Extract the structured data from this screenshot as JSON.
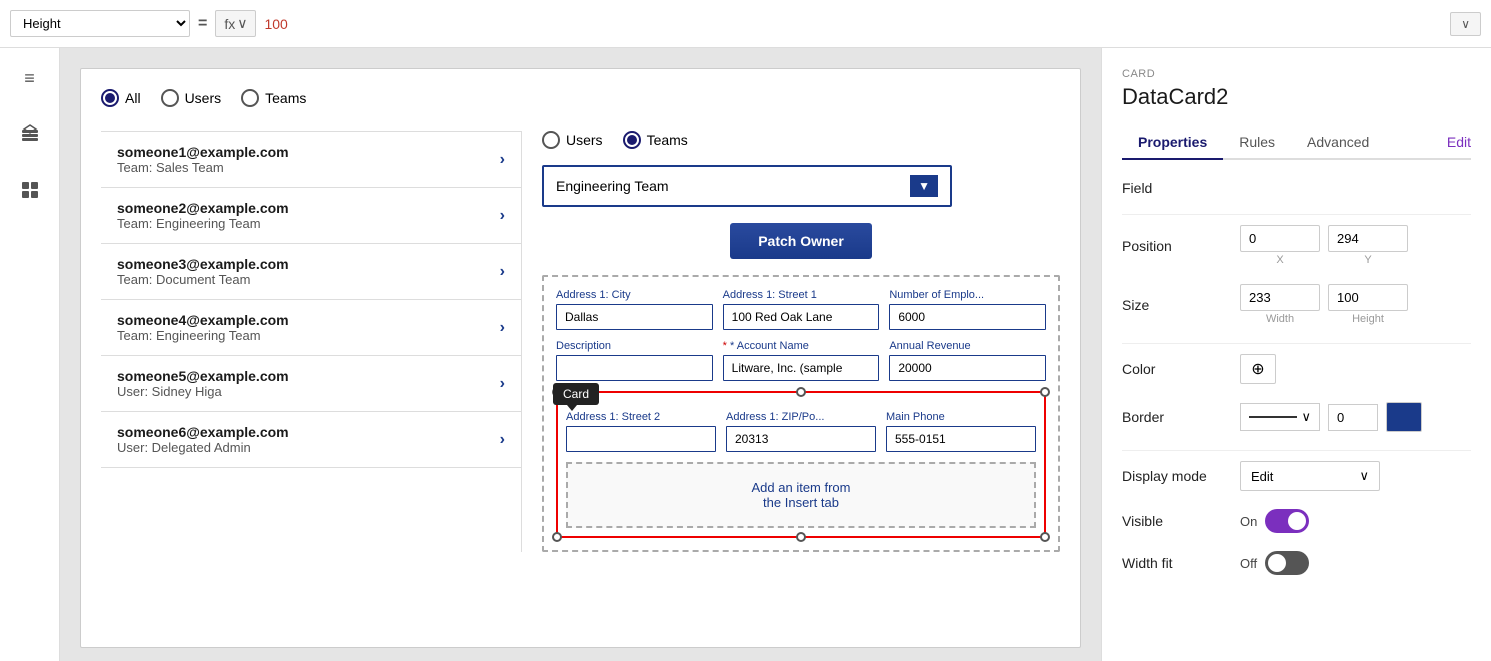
{
  "formulaBar": {
    "heightLabel": "Height",
    "equalsSign": "=",
    "fxLabel": "fx",
    "chevron": "∨",
    "value": "100",
    "expandChevron": "∨"
  },
  "sidebar": {
    "icons": [
      {
        "name": "hamburger-icon",
        "glyph": "≡"
      },
      {
        "name": "layers-icon",
        "glyph": "⧉"
      },
      {
        "name": "dashboard-icon",
        "glyph": "⊞"
      }
    ]
  },
  "canvas": {
    "radioGroupTop": {
      "options": [
        "All",
        "Users",
        "Teams"
      ],
      "selected": "All"
    },
    "users": [
      {
        "email": "someone1@example.com",
        "team": "Team: Sales Team"
      },
      {
        "email": "someone2@example.com",
        "team": "Team: Engineering Team"
      },
      {
        "email": "someone3@example.com",
        "team": "Team: Document Team"
      },
      {
        "email": "someone4@example.com",
        "team": "Team: Engineering Team"
      },
      {
        "email": "someone5@example.com",
        "team": "User: Sidney Higa"
      },
      {
        "email": "someone6@example.com",
        "team": "User: Delegated Admin"
      }
    ],
    "innerCard": {
      "radioOptions": [
        "Users",
        "Teams"
      ],
      "selectedRadio": "Teams",
      "dropdownValue": "Engineering Team",
      "patchOwnerLabel": "Patch Owner",
      "formFields": [
        {
          "label": "Address 1: City",
          "value": "Dallas",
          "required": false
        },
        {
          "label": "Address 1: Street 1",
          "value": "100 Red Oak Lane",
          "required": false
        },
        {
          "label": "Number of Emplo...",
          "value": "6000",
          "required": false
        },
        {
          "label": "Description",
          "value": "",
          "required": false
        },
        {
          "label": "Account Name",
          "value": "Litware, Inc. (sample",
          "required": true
        },
        {
          "label": "Annual Revenue",
          "value": "20000",
          "required": false
        },
        {
          "label": "Address 1: Street 2",
          "value": "",
          "required": false
        },
        {
          "label": "Address 1: ZIP/Po...",
          "value": "20313",
          "required": false
        },
        {
          "label": "Main Phone",
          "value": "555-0151",
          "required": false
        }
      ],
      "cardTooltip": "Card",
      "insertPlaceholder": "Add an item from\nthe Insert tab"
    }
  },
  "propertiesPanel": {
    "cardLabel": "CARD",
    "cardTitle": "DataCard2",
    "tabs": [
      "Properties",
      "Rules",
      "Advanced"
    ],
    "activeTab": "Properties",
    "editLabel": "Edit",
    "fieldLabel": "Field",
    "positionLabel": "Position",
    "positionX": "0",
    "positionY": "294",
    "xAxisLabel": "X",
    "yAxisLabel": "Y",
    "sizeLabel": "Size",
    "sizeWidth": "233",
    "sizeHeight": "100",
    "widthLabel": "Width",
    "heightLabel": "Height",
    "colorLabel": "Color",
    "eyedropperGlyph": "⊕",
    "borderLabel": "Border",
    "borderWidth": "0",
    "borderColor": "#1a3a8a",
    "borderStyleChevron": "∨",
    "displayModeLabel": "Display mode",
    "displayModeValue": "Edit",
    "displayModeChevron": "∨",
    "visibleLabel": "Visible",
    "visibleState": "On",
    "visibleToggle": "on",
    "widthFitLabel": "Width fit",
    "widthFitState": "Off",
    "widthFitToggle": "off"
  }
}
